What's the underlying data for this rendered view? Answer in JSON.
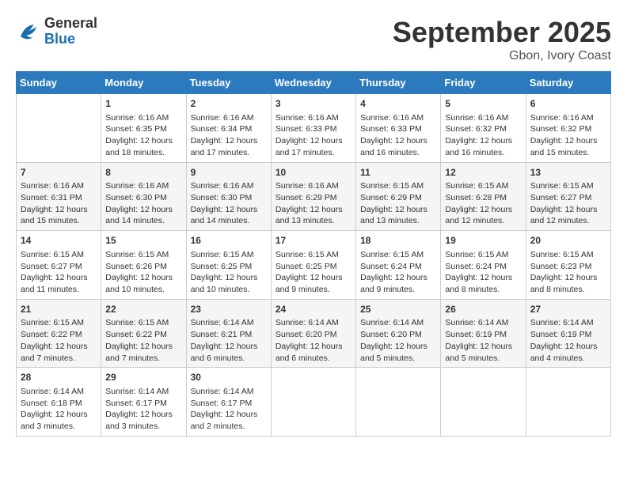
{
  "header": {
    "logo_general": "General",
    "logo_blue": "Blue",
    "month": "September 2025",
    "location": "Gbon, Ivory Coast"
  },
  "calendar": {
    "weekdays": [
      "Sunday",
      "Monday",
      "Tuesday",
      "Wednesday",
      "Thursday",
      "Friday",
      "Saturday"
    ],
    "weeks": [
      [
        {
          "day": "",
          "content": ""
        },
        {
          "day": "1",
          "content": "Sunrise: 6:16 AM\nSunset: 6:35 PM\nDaylight: 12 hours\nand 18 minutes."
        },
        {
          "day": "2",
          "content": "Sunrise: 6:16 AM\nSunset: 6:34 PM\nDaylight: 12 hours\nand 17 minutes."
        },
        {
          "day": "3",
          "content": "Sunrise: 6:16 AM\nSunset: 6:33 PM\nDaylight: 12 hours\nand 17 minutes."
        },
        {
          "day": "4",
          "content": "Sunrise: 6:16 AM\nSunset: 6:33 PM\nDaylight: 12 hours\nand 16 minutes."
        },
        {
          "day": "5",
          "content": "Sunrise: 6:16 AM\nSunset: 6:32 PM\nDaylight: 12 hours\nand 16 minutes."
        },
        {
          "day": "6",
          "content": "Sunrise: 6:16 AM\nSunset: 6:32 PM\nDaylight: 12 hours\nand 15 minutes."
        }
      ],
      [
        {
          "day": "7",
          "content": "Sunrise: 6:16 AM\nSunset: 6:31 PM\nDaylight: 12 hours\nand 15 minutes."
        },
        {
          "day": "8",
          "content": "Sunrise: 6:16 AM\nSunset: 6:30 PM\nDaylight: 12 hours\nand 14 minutes."
        },
        {
          "day": "9",
          "content": "Sunrise: 6:16 AM\nSunset: 6:30 PM\nDaylight: 12 hours\nand 14 minutes."
        },
        {
          "day": "10",
          "content": "Sunrise: 6:16 AM\nSunset: 6:29 PM\nDaylight: 12 hours\nand 13 minutes."
        },
        {
          "day": "11",
          "content": "Sunrise: 6:15 AM\nSunset: 6:29 PM\nDaylight: 12 hours\nand 13 minutes."
        },
        {
          "day": "12",
          "content": "Sunrise: 6:15 AM\nSunset: 6:28 PM\nDaylight: 12 hours\nand 12 minutes."
        },
        {
          "day": "13",
          "content": "Sunrise: 6:15 AM\nSunset: 6:27 PM\nDaylight: 12 hours\nand 12 minutes."
        }
      ],
      [
        {
          "day": "14",
          "content": "Sunrise: 6:15 AM\nSunset: 6:27 PM\nDaylight: 12 hours\nand 11 minutes."
        },
        {
          "day": "15",
          "content": "Sunrise: 6:15 AM\nSunset: 6:26 PM\nDaylight: 12 hours\nand 10 minutes."
        },
        {
          "day": "16",
          "content": "Sunrise: 6:15 AM\nSunset: 6:25 PM\nDaylight: 12 hours\nand 10 minutes."
        },
        {
          "day": "17",
          "content": "Sunrise: 6:15 AM\nSunset: 6:25 PM\nDaylight: 12 hours\nand 9 minutes."
        },
        {
          "day": "18",
          "content": "Sunrise: 6:15 AM\nSunset: 6:24 PM\nDaylight: 12 hours\nand 9 minutes."
        },
        {
          "day": "19",
          "content": "Sunrise: 6:15 AM\nSunset: 6:24 PM\nDaylight: 12 hours\nand 8 minutes."
        },
        {
          "day": "20",
          "content": "Sunrise: 6:15 AM\nSunset: 6:23 PM\nDaylight: 12 hours\nand 8 minutes."
        }
      ],
      [
        {
          "day": "21",
          "content": "Sunrise: 6:15 AM\nSunset: 6:22 PM\nDaylight: 12 hours\nand 7 minutes."
        },
        {
          "day": "22",
          "content": "Sunrise: 6:15 AM\nSunset: 6:22 PM\nDaylight: 12 hours\nand 7 minutes."
        },
        {
          "day": "23",
          "content": "Sunrise: 6:14 AM\nSunset: 6:21 PM\nDaylight: 12 hours\nand 6 minutes."
        },
        {
          "day": "24",
          "content": "Sunrise: 6:14 AM\nSunset: 6:20 PM\nDaylight: 12 hours\nand 6 minutes."
        },
        {
          "day": "25",
          "content": "Sunrise: 6:14 AM\nSunset: 6:20 PM\nDaylight: 12 hours\nand 5 minutes."
        },
        {
          "day": "26",
          "content": "Sunrise: 6:14 AM\nSunset: 6:19 PM\nDaylight: 12 hours\nand 5 minutes."
        },
        {
          "day": "27",
          "content": "Sunrise: 6:14 AM\nSunset: 6:19 PM\nDaylight: 12 hours\nand 4 minutes."
        }
      ],
      [
        {
          "day": "28",
          "content": "Sunrise: 6:14 AM\nSunset: 6:18 PM\nDaylight: 12 hours\nand 3 minutes."
        },
        {
          "day": "29",
          "content": "Sunrise: 6:14 AM\nSunset: 6:17 PM\nDaylight: 12 hours\nand 3 minutes."
        },
        {
          "day": "30",
          "content": "Sunrise: 6:14 AM\nSunset: 6:17 PM\nDaylight: 12 hours\nand 2 minutes."
        },
        {
          "day": "",
          "content": ""
        },
        {
          "day": "",
          "content": ""
        },
        {
          "day": "",
          "content": ""
        },
        {
          "day": "",
          "content": ""
        }
      ]
    ]
  }
}
